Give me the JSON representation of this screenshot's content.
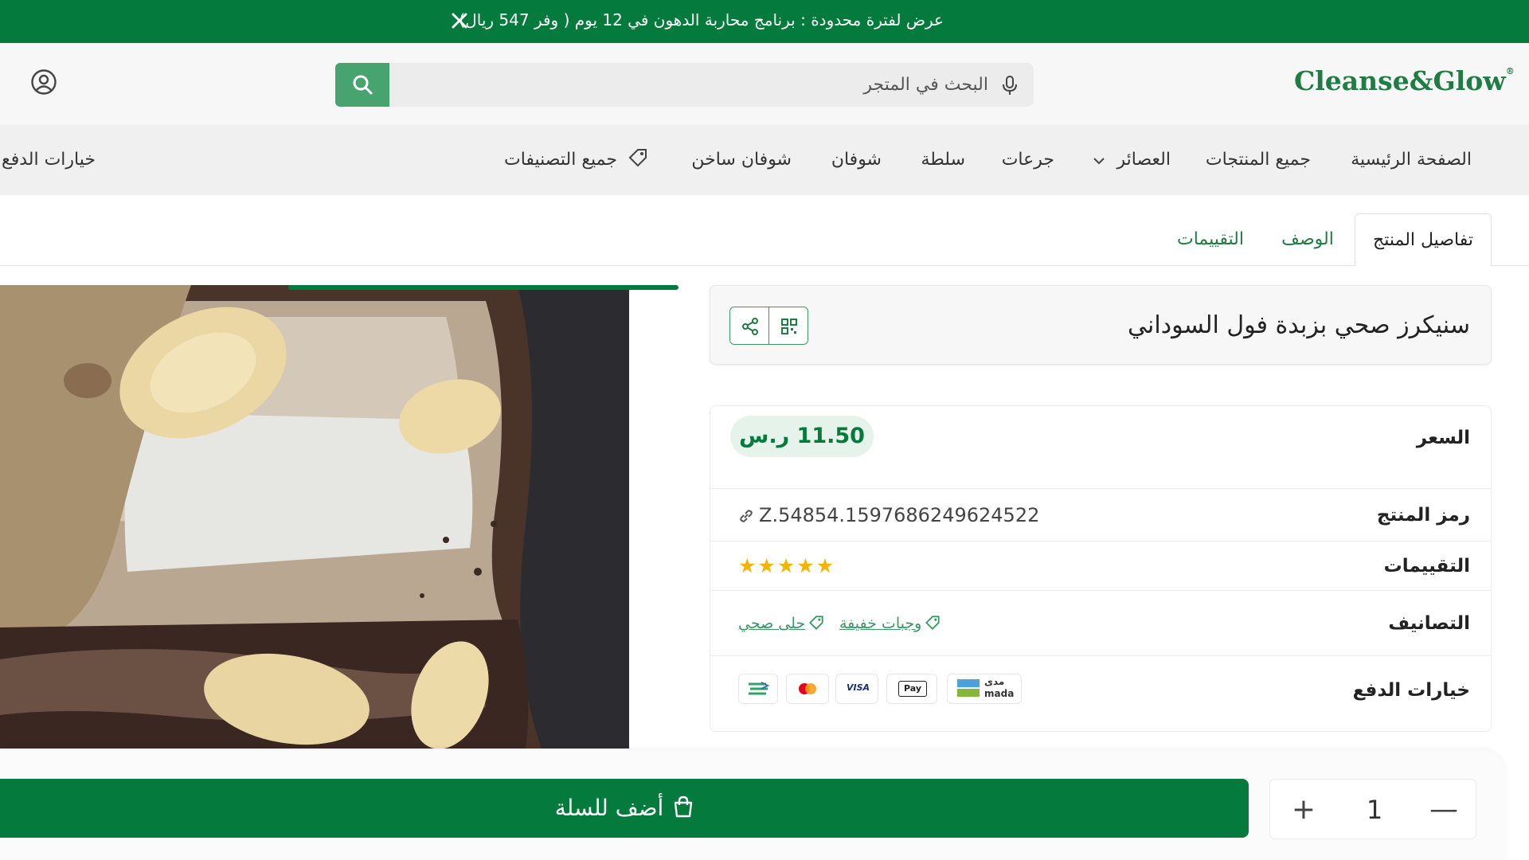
{
  "promo": {
    "text": "عرض لفترة محدودة : برنامج محاربة الدهون في 12 يوم ( وفر 547 ريال)",
    "close_icon": "close-icon"
  },
  "header": {
    "logo": "Cleanse&Glow",
    "logo_mark": "®",
    "search_placeholder": "البحث في المتجر",
    "icons": [
      "user-icon",
      "search-icon",
      "mic-icon"
    ]
  },
  "nav": {
    "items": [
      "الصفحة الرئيسية",
      "جميع المنتجات",
      "العصائر",
      "جرعات",
      "سلطة",
      "شوفان",
      "شوفان ساخن",
      "جميع التصنيفات",
      "خيارات الدفع"
    ]
  },
  "tabs": [
    "تفاصيل المنتج",
    "الوصف",
    "التقييمات"
  ],
  "product": {
    "title": "سنيكرز صحي بزبدة فول السوداني",
    "price_label": "السعر",
    "price": "11.50 ر.س",
    "sku_label": "رمز المنتج",
    "sku": "Z.54854.1597686249624522",
    "rating_label": "التقييمات",
    "rating": 5,
    "rating_max": 5,
    "categories_label": "التصانيف",
    "categories": [
      "وجبات خفيفة",
      "حلى صحي"
    ],
    "payment_label": "خيارات الدفع",
    "payment_methods": [
      "mada",
      "Apple Pay",
      "VISA",
      "Mastercard",
      "STC Pay"
    ],
    "mada_label_ar": "مدى",
    "mada_label_en": "mada",
    "applepay_label": "Pay",
    "visa_label": "VISA"
  },
  "cart": {
    "add_label": "أضف للسلة",
    "quantity": "1",
    "plus": "+",
    "minus": "—"
  },
  "colors": {
    "brand": "#047a3c",
    "accent": "#47a46f",
    "price_bg": "#e6f3ea",
    "star": "#f5b400"
  }
}
